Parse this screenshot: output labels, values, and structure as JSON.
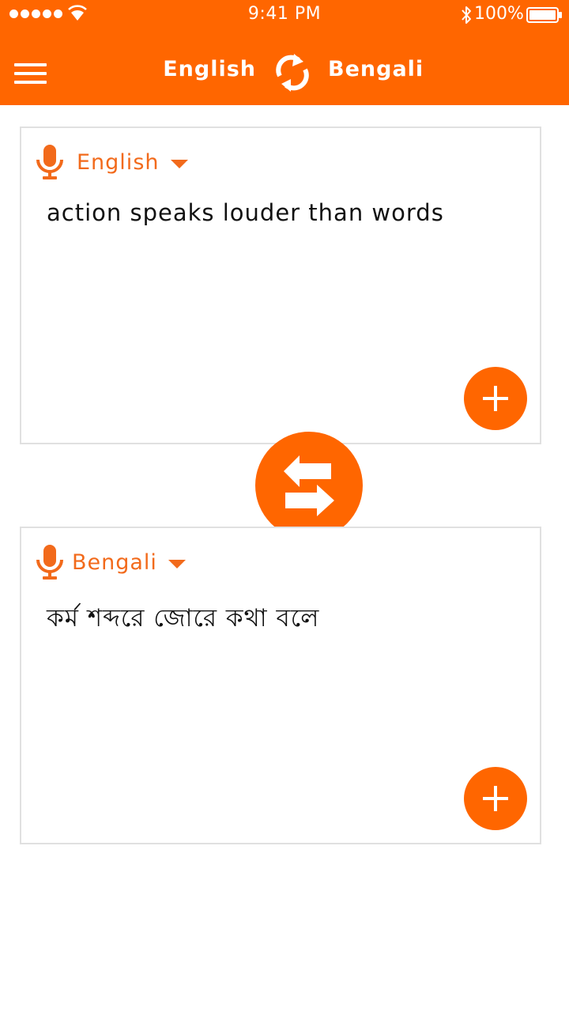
{
  "status_bar": {
    "time": "9:41 PM",
    "battery": "100%",
    "icons": [
      "signal-dots",
      "wifi-icon",
      "bluetooth-icon",
      "battery-icon"
    ]
  },
  "header": {
    "menu_icon": "hamburger-menu-icon",
    "source_language": "English",
    "target_language": "Bengali",
    "swap_icon": "swap-arrows-icon"
  },
  "source_card": {
    "language": "English",
    "text": "action speaks louder than words",
    "mic_icon": "microphone-icon",
    "add_icon": "plus-icon"
  },
  "swap_button": {
    "icon": "swap-arrows-icon"
  },
  "target_card": {
    "language": "Bengali",
    "text": "কর্ম শব্দরে জোরে কথা বলে",
    "mic_icon": "microphone-icon",
    "add_icon": "plus-icon"
  },
  "colors": {
    "accent": "#ff6600",
    "accent_text": "#f26a1b",
    "card_border": "#e0e0e0"
  }
}
